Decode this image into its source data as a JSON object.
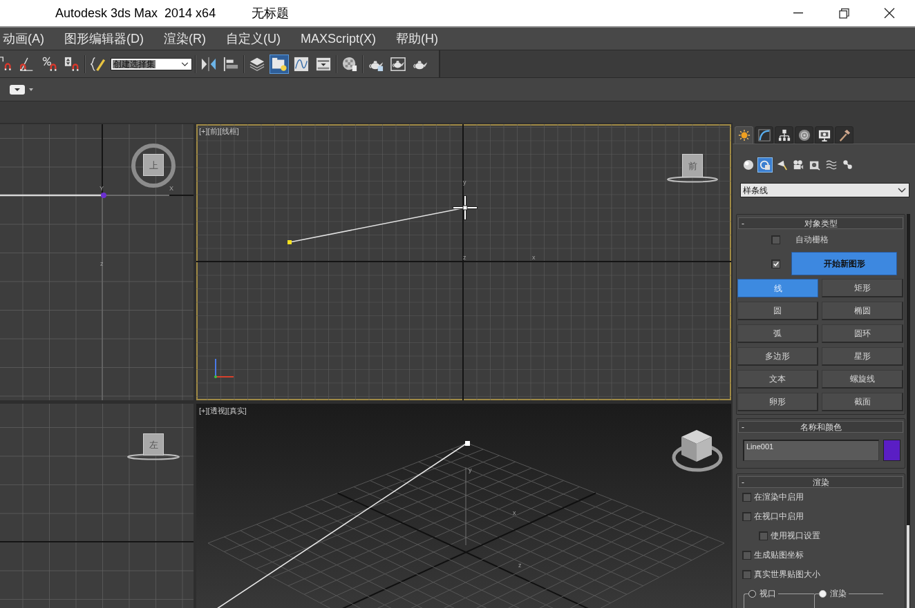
{
  "window": {
    "title": "Autodesk 3ds Max  2014 x64",
    "document": "无标题"
  },
  "menu_bar": [
    {
      "label": "动画(A)"
    },
    {
      "label": "图形编辑器(D)"
    },
    {
      "label": "渲染(R)"
    },
    {
      "label": "自定义(U)"
    },
    {
      "label": "MAXScript(X)"
    },
    {
      "label": "帮助(H)"
    }
  ],
  "main_toolbar": [
    {
      "kind": "snap-3d",
      "selected": false
    },
    {
      "kind": "angle-snap",
      "selected": false
    },
    {
      "kind": "percent-snap",
      "selected": false
    },
    {
      "kind": "spinner-snap",
      "selected": false
    },
    {
      "kind": "separator"
    },
    {
      "kind": "edit-named-sets",
      "selected": false
    },
    {
      "kind": "selection-set",
      "value": "创建选择集"
    },
    {
      "kind": "separator"
    },
    {
      "kind": "mirror",
      "selected": false
    },
    {
      "kind": "align",
      "selected": false
    },
    {
      "kind": "separator"
    },
    {
      "kind": "layers",
      "selected": false
    },
    {
      "kind": "scene-explorer",
      "selected": true
    },
    {
      "kind": "curve-editor",
      "selected": false
    },
    {
      "kind": "schematic",
      "selected": false
    },
    {
      "kind": "separator"
    },
    {
      "kind": "material-editor",
      "selected": false
    },
    {
      "kind": "separator"
    },
    {
      "kind": "render-setup",
      "selected": false
    },
    {
      "kind": "render-frame",
      "selected": false
    },
    {
      "kind": "render",
      "selected": false
    }
  ],
  "viewports": [
    {
      "kind": "top",
      "active": false,
      "viewcube": "上",
      "axis_labels": [
        "Y",
        "X",
        "z"
      ]
    },
    {
      "kind": "front",
      "active": true,
      "menus": [
        "[+]",
        "[前]",
        "[线框]"
      ],
      "viewcube": "前",
      "axis_labels": [
        "y",
        "z",
        "x"
      ]
    },
    {
      "kind": "left",
      "active": false,
      "viewcube": "左"
    },
    {
      "kind": "perspective",
      "active": false,
      "menus": [
        "[+]",
        "[透视]",
        "[真实]"
      ],
      "axis_labels": [
        "y",
        "x",
        "z"
      ]
    }
  ],
  "command_panel": {
    "tabs": [
      {
        "kind": "create",
        "selected": true
      },
      {
        "kind": "modify",
        "selected": false
      },
      {
        "kind": "hierarchy",
        "selected": false
      },
      {
        "kind": "motion",
        "selected": false
      },
      {
        "kind": "display",
        "selected": false
      },
      {
        "kind": "utilities",
        "selected": false
      }
    ],
    "categories": [
      {
        "kind": "geometry",
        "selected": false
      },
      {
        "kind": "shapes",
        "selected": true
      },
      {
        "kind": "lights",
        "selected": false
      },
      {
        "kind": "cameras",
        "selected": false
      },
      {
        "kind": "helpers",
        "selected": false
      },
      {
        "kind": "space-warps",
        "selected": false
      },
      {
        "kind": "systems",
        "selected": false
      }
    ],
    "object_class": {
      "value": "样条线"
    },
    "rollouts": [
      {
        "kind": "object-type",
        "toggle": "-",
        "title": "对象类型",
        "auto_grid": {
          "label": "自动栅格",
          "checked": false
        },
        "start_new_shape": {
          "label": "开始新图形",
          "checked": true
        },
        "buttons": [
          {
            "label": "线",
            "selected": true
          },
          {
            "label": "矩形",
            "selected": false
          },
          {
            "label": "圆",
            "selected": false
          },
          {
            "label": "椭圆",
            "selected": false
          },
          {
            "label": "弧",
            "selected": false
          },
          {
            "label": "圆环",
            "selected": false
          },
          {
            "label": "多边形",
            "selected": false
          },
          {
            "label": "星形",
            "selected": false
          },
          {
            "label": "文本",
            "selected": false
          },
          {
            "label": "螺旋线",
            "selected": false
          },
          {
            "label": "卵形",
            "selected": false
          },
          {
            "label": "截面",
            "selected": false
          }
        ]
      },
      {
        "kind": "name-color",
        "toggle": "-",
        "title": "名称和颜色",
        "name": "Line001",
        "color": "#5a1ec4"
      },
      {
        "kind": "rendering",
        "toggle": "-",
        "title": "渲染",
        "options": [
          {
            "label": "在渲染中启用",
            "checked": false
          },
          {
            "label": "在视口中启用",
            "checked": false,
            "children": [
              {
                "label": "使用视口设置",
                "checked": false
              }
            ]
          },
          {
            "label": "生成贴图坐标",
            "checked": false
          },
          {
            "label": "真实世界贴图大小",
            "checked": false
          }
        ],
        "mode": [
          {
            "label": "视口",
            "selected": false
          },
          {
            "label": "渲染",
            "selected": true
          }
        ]
      }
    ]
  }
}
